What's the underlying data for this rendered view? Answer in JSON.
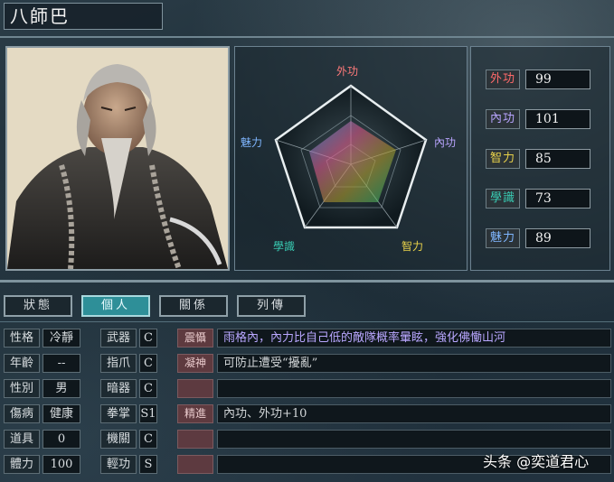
{
  "character": {
    "name": "八師巴"
  },
  "radar": {
    "axes": [
      "外功",
      "內功",
      "智力",
      "學識",
      "魅力"
    ],
    "axis_colors": [
      "#ff6a6a",
      "#b9a5ff",
      "#e8d14a",
      "#38c9b1",
      "#7fb6ff"
    ]
  },
  "stats": [
    {
      "label": "外功",
      "value": "99",
      "color": "#ff6a6a"
    },
    {
      "label": "內功",
      "value": "101",
      "color": "#b9a5ff"
    },
    {
      "label": "智力",
      "value": "85",
      "color": "#e8d14a"
    },
    {
      "label": "學識",
      "value": "73",
      "color": "#38c9b1"
    },
    {
      "label": "魅力",
      "value": "89",
      "color": "#7fb6ff"
    }
  ],
  "tabs": [
    "狀態",
    "個人",
    "關係",
    "列傳"
  ],
  "active_tab": "個人",
  "info": [
    {
      "k": "性格",
      "v": "冷靜",
      "k2": "武器",
      "v2": "C"
    },
    {
      "k": "年齡",
      "v": "--",
      "k2": "指爪",
      "v2": "C"
    },
    {
      "k": "性別",
      "v": "男",
      "k2": "暗器",
      "v2": "C"
    },
    {
      "k": "傷病",
      "v": "健康",
      "k2": "拳掌",
      "v2": "S1"
    },
    {
      "k": "道具",
      "v": "0",
      "k2": "機關",
      "v2": "C"
    },
    {
      "k": "體力",
      "v": "100",
      "k2": "輕功",
      "v2": "S"
    }
  ],
  "skills": [
    {
      "tag": "震懾",
      "desc": "雨格內，內力比自己低的敵隊概率暈眩，強化佛慟山河"
    },
    {
      "tag": "凝神",
      "desc": "可防止遭受“擾亂”"
    },
    {
      "tag": "",
      "desc": ""
    },
    {
      "tag": "精進",
      "desc": "內功、外功+10"
    },
    {
      "tag": "",
      "desc": ""
    },
    {
      "tag": "",
      "desc": ""
    }
  ],
  "watermark": "头条 @奕道君心"
}
